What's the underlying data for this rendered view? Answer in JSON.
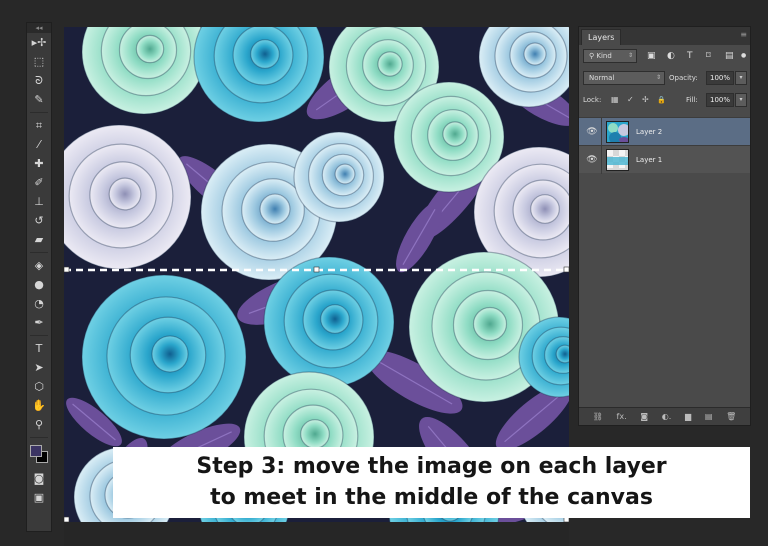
{
  "tools": {
    "grip": "◂◂",
    "items": [
      {
        "name": "move-tool",
        "icon": "move-icon",
        "glyph": "▸✢"
      },
      {
        "name": "marquee-tool",
        "icon": "marquee-icon",
        "glyph": "⬚"
      },
      {
        "name": "lasso-tool",
        "icon": "lasso-icon",
        "glyph": "ᘐ"
      },
      {
        "name": "quick-selection-tool",
        "icon": "quick-selection-icon",
        "glyph": "✎"
      },
      {
        "name": "crop-tool",
        "icon": "crop-icon",
        "glyph": "⌗"
      },
      {
        "name": "eyedropper-tool",
        "icon": "eyedropper-icon",
        "glyph": "⁄"
      },
      {
        "name": "healing-brush-tool",
        "icon": "bandage-icon",
        "glyph": "✚"
      },
      {
        "name": "brush-tool",
        "icon": "brush-icon",
        "glyph": "✐"
      },
      {
        "name": "clone-stamp-tool",
        "icon": "stamp-icon",
        "glyph": "⊥"
      },
      {
        "name": "history-brush-tool",
        "icon": "history-brush-icon",
        "glyph": "↺"
      },
      {
        "name": "eraser-tool",
        "icon": "eraser-icon",
        "glyph": "▰"
      },
      {
        "name": "paint-bucket-tool",
        "icon": "bucket-icon",
        "glyph": "◈"
      },
      {
        "name": "blur-tool",
        "icon": "drop-icon",
        "glyph": "●"
      },
      {
        "name": "dodge-tool",
        "icon": "dodge-icon",
        "glyph": "◔"
      },
      {
        "name": "pen-tool",
        "icon": "pen-icon",
        "glyph": "✒"
      },
      {
        "name": "type-tool",
        "icon": "type-icon",
        "glyph": "T"
      },
      {
        "name": "path-selection-tool",
        "icon": "arrow-icon",
        "glyph": "➤"
      },
      {
        "name": "shape-tool",
        "icon": "shape-icon",
        "glyph": "⬡"
      },
      {
        "name": "hand-tool",
        "icon": "hand-icon",
        "glyph": "✋"
      },
      {
        "name": "zoom-tool",
        "icon": "zoom-icon",
        "glyph": "⚲"
      }
    ],
    "foreground_color": "#3b3463",
    "background_color": "#000000",
    "screen_mode_glyph": "▣",
    "quick_mask_glyph": "◙"
  },
  "layers_panel": {
    "collapse_glyph": "◂◂",
    "tab": "Layers",
    "menu_glyph": "≡",
    "filter": {
      "label": "Kind",
      "search_glyph": "⚲",
      "arrow": "⇕",
      "icons": [
        "▣",
        "◐",
        "T",
        "⌑",
        "▤"
      ],
      "toggle": "●"
    },
    "blend_mode": "Normal",
    "opacity_label": "Opacity:",
    "opacity_value": "100%",
    "lock_label": "Lock:",
    "lock_icons": [
      "▦",
      "✓",
      "✢",
      "🔒"
    ],
    "fill_label": "Fill:",
    "fill_value": "100%",
    "dropdown_arrow": "▾",
    "layers": [
      {
        "name": "Layer 2",
        "selected": true,
        "eye": "👁"
      },
      {
        "name": "Layer 1",
        "selected": false,
        "eye": "👁"
      }
    ],
    "bottom_icons": [
      {
        "name": "link-icon",
        "glyph": "⛓"
      },
      {
        "name": "fx-icon",
        "glyph": "fx."
      },
      {
        "name": "mask-icon",
        "glyph": "◙"
      },
      {
        "name": "adjustment-icon",
        "glyph": "◐."
      },
      {
        "name": "folder-icon",
        "glyph": "▆"
      },
      {
        "name": "new-layer-icon",
        "glyph": "▤"
      },
      {
        "name": "trash-icon",
        "glyph": "🗑"
      }
    ]
  },
  "caption": {
    "line1": "Step 3: move the image on each layer",
    "line2": "to meet in the middle of the canvas"
  },
  "colors": {
    "teal_rose": "#2aa6cc",
    "mint_rose": "#8fdcc4",
    "lavender_rose": "#c7c9e0",
    "purple_leaf": "#6b4f9a",
    "background": "#1b1f3a",
    "selected_layer": "#5b6d85"
  }
}
